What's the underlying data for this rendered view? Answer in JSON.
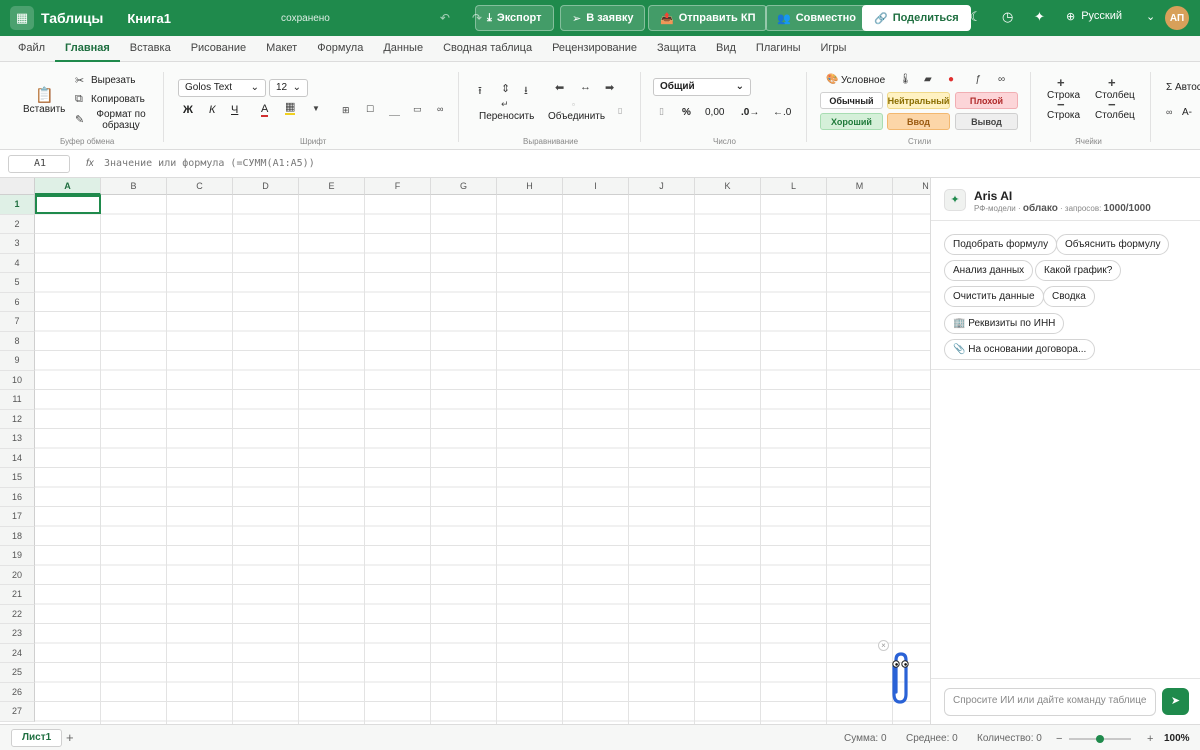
{
  "topbar": {
    "app_name": "Таблицы",
    "book_name": "Книга1",
    "saved_status": "сохранено",
    "export": "Экспорт",
    "request": "В заявку",
    "send_kp": "Отправить КП",
    "collab": "Совместно",
    "share": "Поделиться",
    "language": "Русский",
    "avatar_initials": "АП"
  },
  "menu": [
    "Файл",
    "Главная",
    "Вставка",
    "Рисование",
    "Макет",
    "Формула",
    "Данные",
    "Сводная таблица",
    "Рецензирование",
    "Защита",
    "Вид",
    "Плагины",
    "Игры"
  ],
  "ribbon": {
    "paste": "Вставить",
    "cut": "Вырезать",
    "copy": "Копировать",
    "format_painter": "Формат по образцу",
    "clipboard_group": "Буфер обмена",
    "font_name": "Golos Text",
    "font_size": "12",
    "bold": "Ж",
    "italic": "К",
    "underline": "Ч",
    "font_color": "А",
    "font_group": "Шрифт",
    "wrap": "Переносить",
    "merge": "Объединить",
    "align_group": "Выравнивание",
    "number_format": "Общий",
    "percent": "%",
    "decimals": "0,00",
    "inc_decimal": ".0→",
    "dec_decimal": "←.0",
    "number_group": "Число",
    "conditional": "Условное",
    "styles": {
      "normal": "Обычный",
      "neutral": "Нейтральный",
      "bad": "Плохой",
      "good": "Хороший",
      "input": "Ввод",
      "output": "Вывод"
    },
    "styles_group": "Стили",
    "insert_row": "Строка",
    "insert_col": "Столбец",
    "delete_row": "Строка",
    "delete_col": "Столбец",
    "cells_group": "Ячейки",
    "autosum": "Σ Автос",
    "clear": "А-"
  },
  "formula_bar": {
    "cell_ref": "A1",
    "fx": "fx",
    "placeholder": "Значение или формула (=СУММ(A1:A5))"
  },
  "grid": {
    "columns": [
      "A",
      "B",
      "C",
      "D",
      "E",
      "F",
      "G",
      "H",
      "I",
      "J",
      "K",
      "L",
      "M",
      "N"
    ],
    "rows": [
      "1",
      "2",
      "3",
      "4",
      "5",
      "6",
      "7",
      "8",
      "9",
      "10",
      "11",
      "12",
      "13",
      "14",
      "15",
      "16",
      "17",
      "18",
      "19",
      "20",
      "21",
      "22",
      "23",
      "24",
      "25",
      "26",
      "27"
    ],
    "active_col": "A",
    "active_row": "1"
  },
  "ai": {
    "title": "Aris AI",
    "subtitle_prefix": "РФ-модели ·",
    "mode": "облако",
    "quota_label": "· запросов:",
    "quota": "1000/1000",
    "suggestions": [
      "Подобрать формулу",
      "Объяснить формулу",
      "Анализ данных",
      "Какой график?",
      "Очистить данные",
      "Сводка",
      "🏢 Реквизиты по ИНН",
      "📎 На основании договора..."
    ],
    "input_placeholder": "Спросите ИИ или дайте команду таблице",
    "send_icon": "➤"
  },
  "status": {
    "sheet": "Лист1",
    "add": "+",
    "sum": "Сумма: 0",
    "avg": "Среднее: 0",
    "count": "Количество: 0",
    "zoom_minus": "−",
    "zoom_plus": "+",
    "zoom": "100%",
    "zoom_level": 0.5
  },
  "colors": {
    "brand": "#1f8a4c",
    "neutral_bg": "#fff2c2",
    "bad_bg": "#fcd5d8",
    "good_bg": "#d5f0d9",
    "input_bg": "#fcd6a8",
    "output_bg": "#eeeeee"
  }
}
